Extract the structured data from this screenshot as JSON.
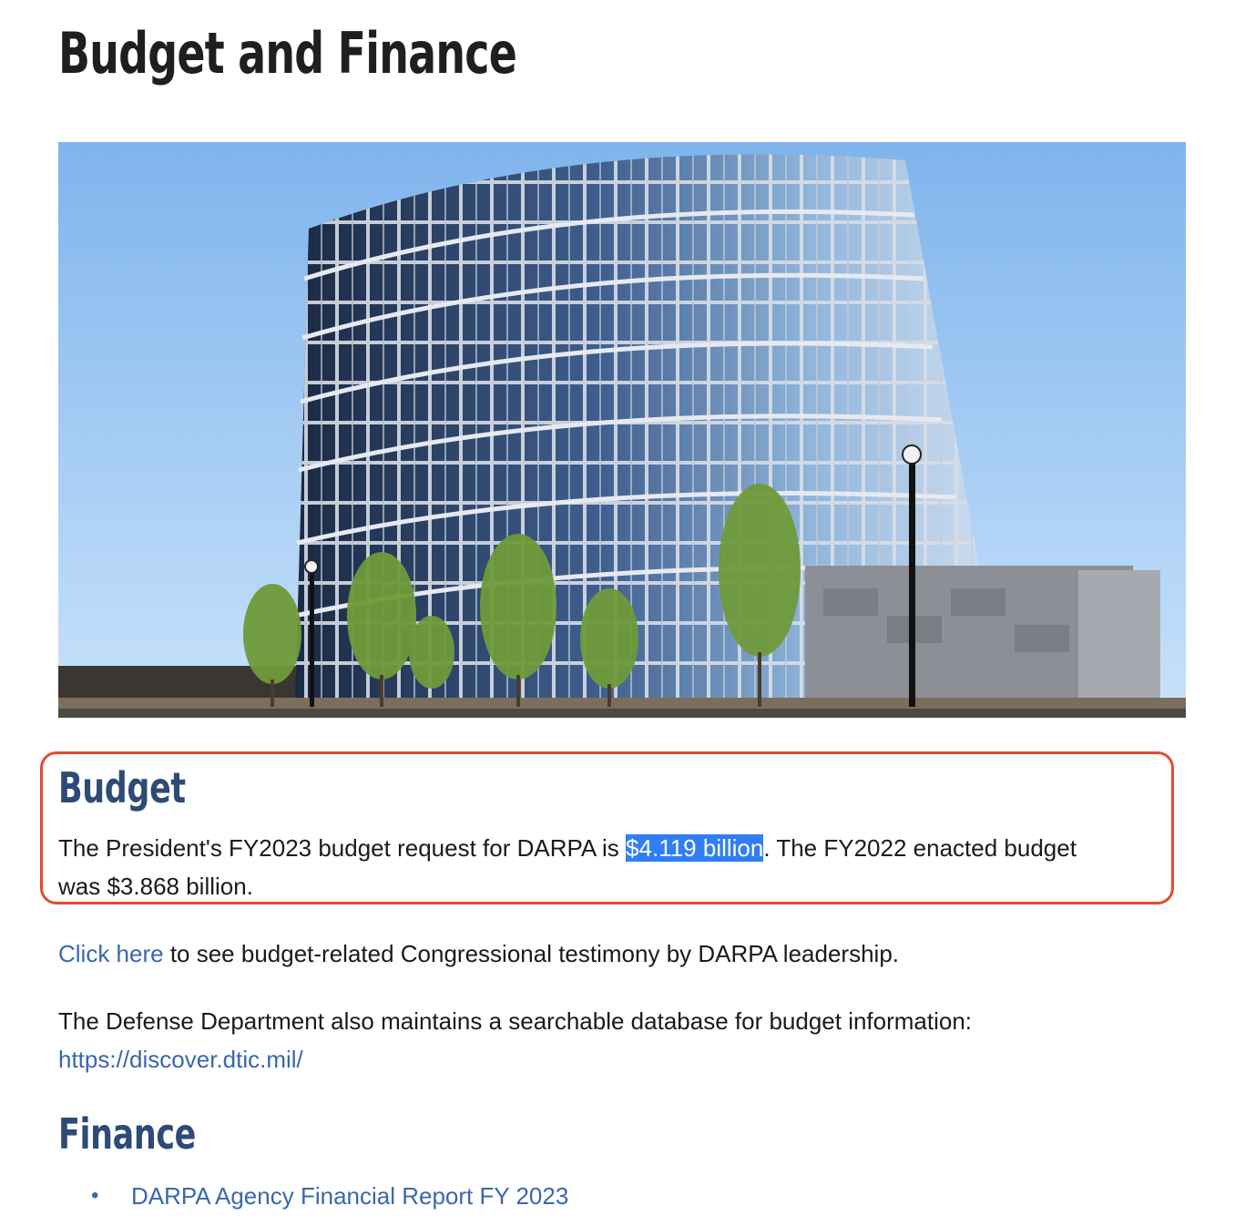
{
  "page": {
    "title": "Budget and Finance"
  },
  "hero": {
    "icon": "building-photo"
  },
  "budget": {
    "heading": "Budget",
    "text_before": "The President's FY2023 budget request for DARPA is ",
    "highlight": "$4.119 billion",
    "text_after_line1": ". The FY2022 enacted budget",
    "text_line2": "was $3.868 billion."
  },
  "testimony": {
    "link_text": "Click here",
    "rest": " to see budget-related Congressional testimony by DARPA leadership."
  },
  "database": {
    "text": "The Defense Department also maintains a searchable database for budget information:",
    "link_text": "https://discover.dtic.mil/"
  },
  "finance": {
    "heading": "Finance",
    "items": [
      {
        "label": "DARPA Agency Financial Report FY 2023"
      }
    ]
  },
  "colors": {
    "heading_blue": "#2e4a76",
    "link_blue": "#3a67ad",
    "selection_blue": "#2f7ef6",
    "frame_red": "#e34a33"
  }
}
